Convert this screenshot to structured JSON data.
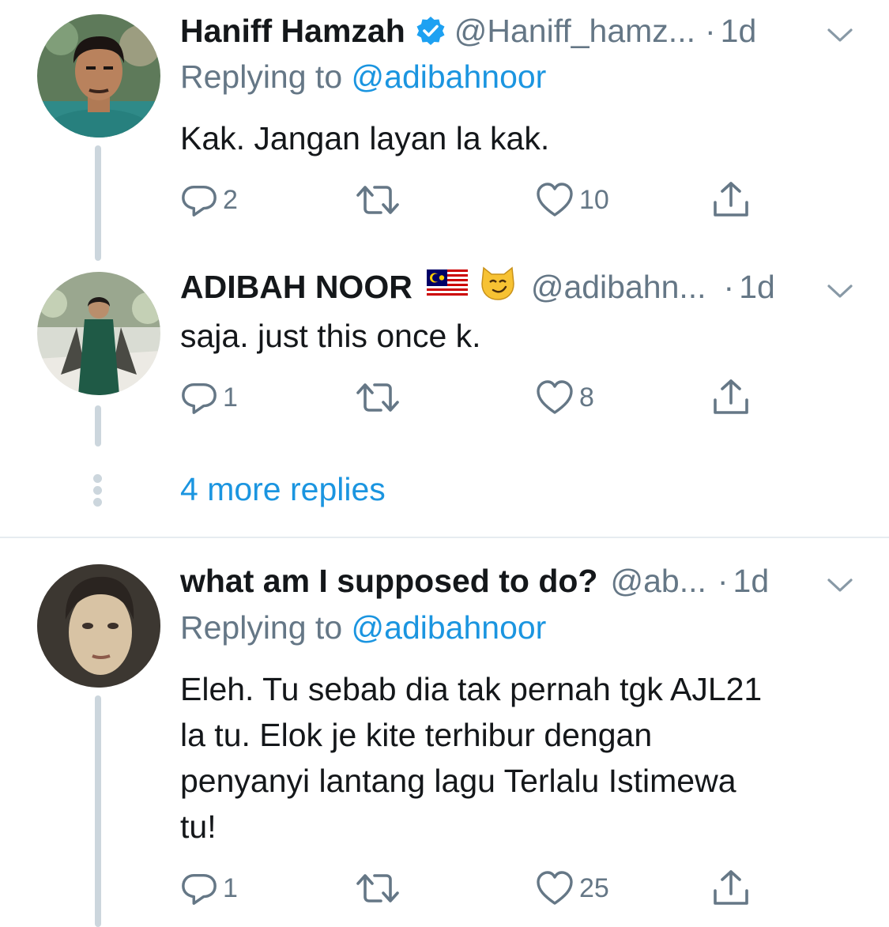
{
  "tweets": [
    {
      "name": "Haniff Hamzah",
      "verified": true,
      "handle": "@Haniff_hamz...",
      "dot": "·",
      "time": "1d",
      "replying_prefix": "Replying to",
      "replying_to": "@adibahnoor",
      "text": "Kak. Jangan layan la kak.",
      "replies": "2",
      "retweets": "",
      "likes": "10"
    },
    {
      "name": "ADIBAH NOOR",
      "flag_emoji": "🇲🇾",
      "emoji": "😼",
      "handle": "@adibahn...",
      "dot": "·",
      "time": "1d",
      "text": "saja. just this once k.",
      "replies": "1",
      "retweets": "",
      "likes": "8"
    },
    {
      "name": "what am I supposed to do?",
      "handle": "@ab...",
      "dot": "·",
      "time": "1d",
      "replying_prefix": "Replying to",
      "replying_to": "@adibahnoor",
      "text_lines": [
        "Eleh. Tu sebab dia tak pernah tgk AJL21",
        "la tu. Elok je kite terhibur dengan",
        "penyanyi lantang lagu Terlalu Istimewa",
        "tu!"
      ],
      "replies": "1",
      "retweets": "",
      "likes": "25"
    }
  ],
  "more_replies": "4 more replies",
  "colors": {
    "link": "#1b95e0",
    "muted": "#657786",
    "line": "#ccd6dd",
    "verified": "#1da1f2"
  },
  "icons": [
    "reply-icon",
    "retweet-icon",
    "like-icon",
    "share-icon",
    "verified-badge-icon",
    "chevron-down-icon"
  ]
}
